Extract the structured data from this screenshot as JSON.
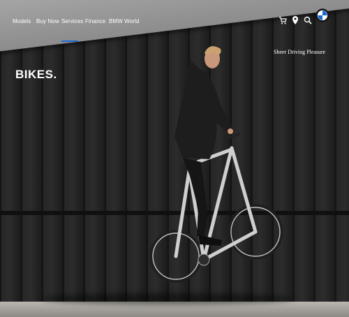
{
  "nav": {
    "items": [
      {
        "label": "Models"
      },
      {
        "label": "Buy Now"
      },
      {
        "label": "Services"
      },
      {
        "label": "Finance"
      },
      {
        "label": "BMW World"
      }
    ],
    "active_index": 2,
    "icons": [
      "cart-icon",
      "location-pin-icon",
      "search-icon",
      "user-icon"
    ],
    "accent_color": "#1c69d4"
  },
  "brand": {
    "logo": "bmw-logo"
  },
  "hero": {
    "headline": "BIKES.",
    "tagline": "Sheer Driving Pleasure"
  }
}
